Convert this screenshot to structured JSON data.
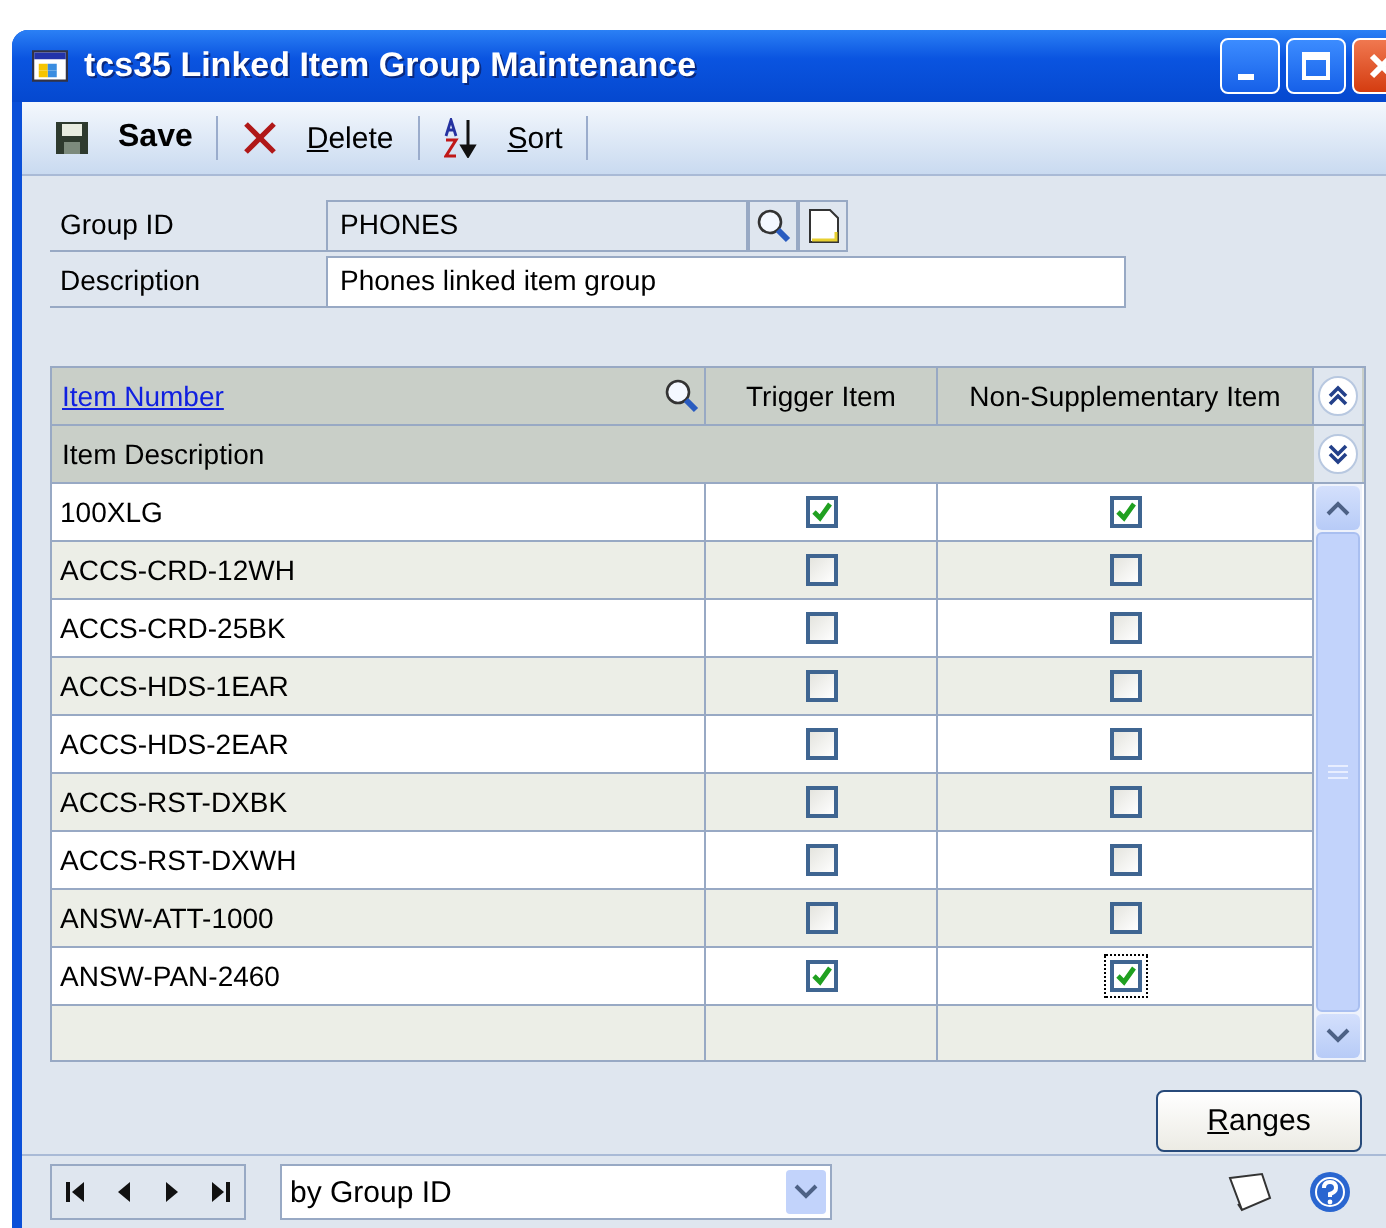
{
  "window": {
    "title": "tcs35 Linked Item Group Maintenance"
  },
  "toolbar": [
    {
      "kind": "save",
      "label": "Save"
    },
    {
      "kind": "delete",
      "label": "Delete"
    },
    {
      "kind": "sort",
      "label": "Sort"
    }
  ],
  "form": {
    "group_id": {
      "label": "Group ID",
      "value": "PHONES"
    },
    "description": {
      "label": "Description",
      "value": "Phones linked item group"
    }
  },
  "table": {
    "columns": [
      "Item Number",
      "Trigger Item",
      "Non-Supplementary Item"
    ],
    "subheader": "Item Description",
    "rows": [
      {
        "item_number": "100XLG",
        "trigger_item": true,
        "non_supplementary_item": true,
        "focused": false
      },
      {
        "item_number": "ACCS-CRD-12WH",
        "trigger_item": false,
        "non_supplementary_item": false,
        "focused": false
      },
      {
        "item_number": "ACCS-CRD-25BK",
        "trigger_item": false,
        "non_supplementary_item": false,
        "focused": false
      },
      {
        "item_number": "ACCS-HDS-1EAR",
        "trigger_item": false,
        "non_supplementary_item": false,
        "focused": false
      },
      {
        "item_number": "ACCS-HDS-2EAR",
        "trigger_item": false,
        "non_supplementary_item": false,
        "focused": false
      },
      {
        "item_number": "ACCS-RST-DXBK",
        "trigger_item": false,
        "non_supplementary_item": false,
        "focused": false
      },
      {
        "item_number": "ACCS-RST-DXWH",
        "trigger_item": false,
        "non_supplementary_item": false,
        "focused": false
      },
      {
        "item_number": "ANSW-ATT-1000",
        "trigger_item": false,
        "non_supplementary_item": false,
        "focused": false
      },
      {
        "item_number": "ANSW-PAN-2460",
        "trigger_item": true,
        "non_supplementary_item": true,
        "focused": true
      }
    ]
  },
  "buttons": [
    "Ranges"
  ],
  "status_bar": {
    "browse_by": "by Group ID"
  }
}
